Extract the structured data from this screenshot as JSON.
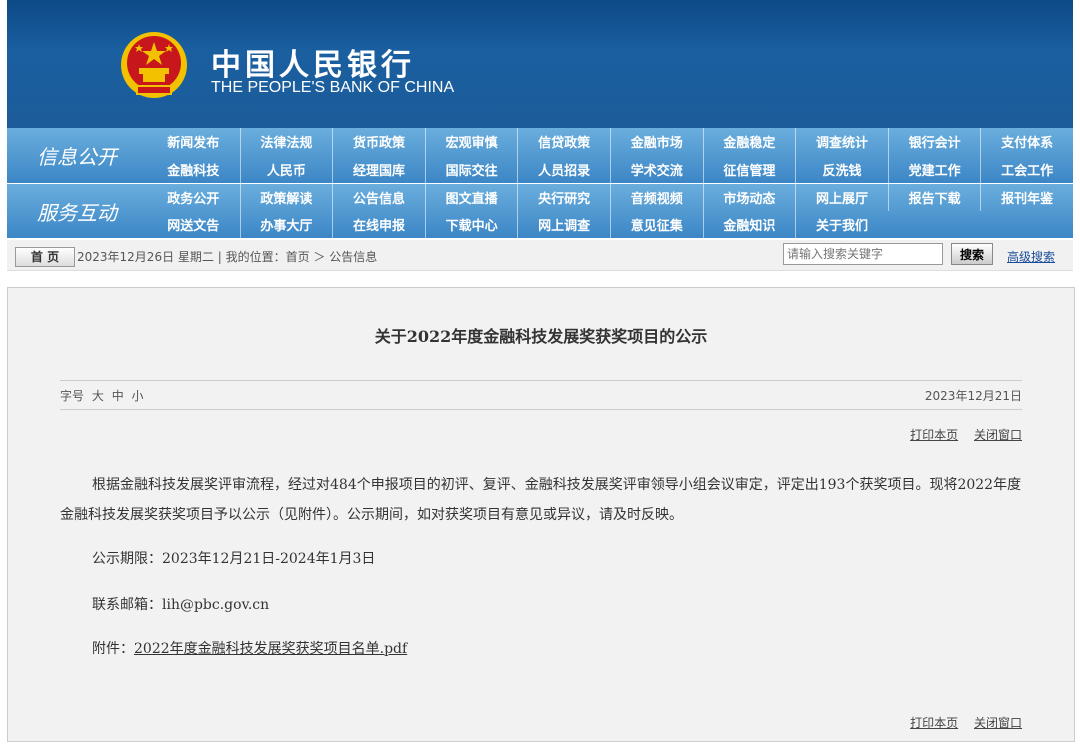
{
  "header": {
    "logo_cn": "中国人民银行",
    "logo_en": "THE PEOPLE'S BANK OF CHINA",
    "emblem_icon": "national-emblem-icon",
    "colors": {
      "banner": "#1a5fa0",
      "nav": "#3c86c6",
      "accent_red": "#c8161d",
      "gold": "#f2c200"
    }
  },
  "nav": {
    "info_title": "信息公开",
    "info_items": [
      "新闻发布",
      "法律法规",
      "货币政策",
      "宏观审慎",
      "信贷政策",
      "金融市场",
      "金融稳定",
      "调查统计",
      "银行会计",
      "支付体系",
      "金融科技",
      "人民币",
      "经理国库",
      "国际交往",
      "人员招录",
      "学术交流",
      "征信管理",
      "反洗钱",
      "党建工作",
      "工会工作"
    ],
    "service_title": "服务互动",
    "service_items": [
      "政务公开",
      "政策解读",
      "公告信息",
      "图文直播",
      "央行研究",
      "音频视频",
      "市场动态",
      "网上展厅",
      "报告下载",
      "报刊年鉴",
      "网送文告",
      "办事大厅",
      "在线申报",
      "下载中心",
      "网上调查",
      "意见征集",
      "金融知识",
      "关于我们"
    ]
  },
  "crumb": {
    "home": "首 页",
    "text": "2023年12月26日 星期二 | 我的位置：首页 ＞ 公告信息",
    "search_placeholder": "请输入搜索关键字",
    "search_button": "搜索",
    "advanced_search": "高级搜索"
  },
  "article": {
    "title": "关于2022年度金融科技发展奖获奖项目的公示",
    "font_size_label": "字号",
    "font_sizes": [
      "大",
      "中",
      "小"
    ],
    "date": "2023年12月21日",
    "print": "打印本页",
    "close": "关闭窗口",
    "paragraph1": "根据金融科技发展奖评审流程，经过对484个申报项目的初评、复评、金融科技发展奖评审领导小组会议审定，评定出193个获奖项目。现将2022年度金融科技发展奖获奖项目予以公示（见附件）。公示期间，如对获奖项目有意见或异议，请及时反映。",
    "period": "公示期限：2023年12月21日-2024年1月3日",
    "email": "联系邮箱：lih@pbc.gov.cn",
    "attachment_label": "附件：",
    "attachment_link": "2022年度金融科技发展奖获奖项目名单.pdf"
  }
}
